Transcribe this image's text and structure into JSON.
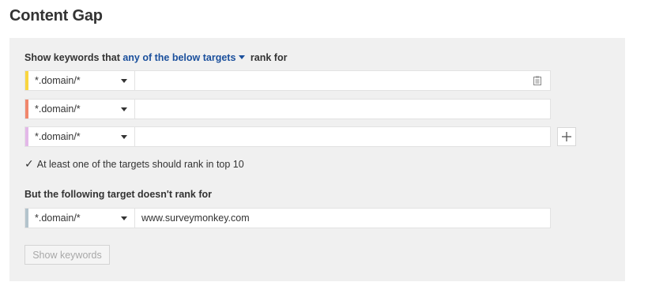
{
  "page": {
    "title": "Content Gap"
  },
  "targets_section": {
    "label_prefix": "Show keywords that",
    "mode_link": "any of the below targets",
    "label_suffix": "rank for",
    "rows": [
      {
        "mode": "*.domain/*",
        "value": "",
        "color": "#f9d53f"
      },
      {
        "mode": "*.domain/*",
        "value": "",
        "color": "#f0866c"
      },
      {
        "mode": "*.domain/*",
        "value": "",
        "color": "#e3b8e8"
      }
    ]
  },
  "top10_checkbox": {
    "checked": true,
    "label": "At least one of the targets should rank in top 10"
  },
  "exclude_section": {
    "label": "But the following target doesn't rank for",
    "row": {
      "mode": "*.domain/*",
      "value": "www.surveymonkey.com",
      "color": "#b3c3cc"
    }
  },
  "actions": {
    "show_keywords_label": "Show keywords"
  },
  "icons": {
    "paste": "clipboard-icon",
    "add": "plus-icon",
    "dropdown": "caret-down-icon",
    "check": "checkmark-icon"
  }
}
